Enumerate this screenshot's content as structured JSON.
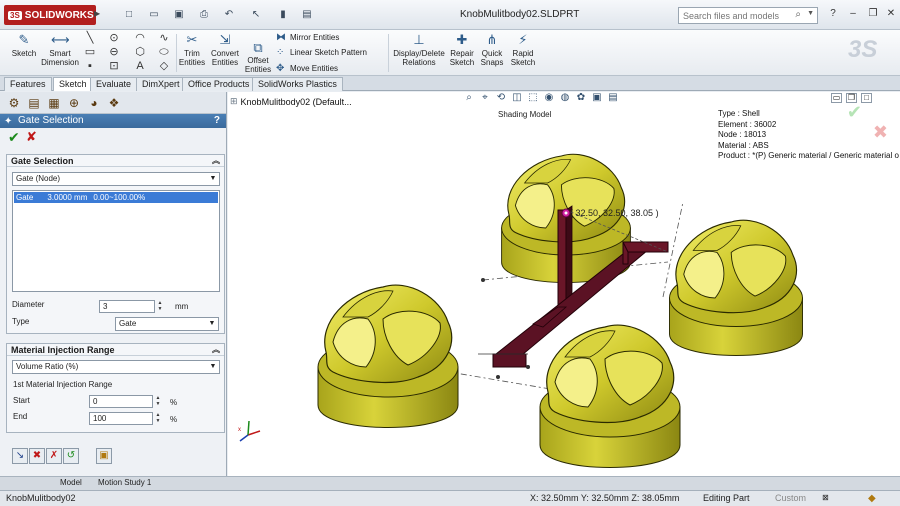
{
  "titlebar": {
    "brand": "SOLIDWORKS",
    "brand_prefix": "3S",
    "document_title": "KnobMulitbody02.SLDPRT",
    "search_placeholder": "Search files and models",
    "help_label": "?"
  },
  "command_manager": {
    "sketch": "Sketch",
    "smart_dimension": [
      "Smart",
      "Dimension"
    ],
    "trim_entities": [
      "Trim",
      "Entities"
    ],
    "convert_entities": [
      "Convert",
      "Entities"
    ],
    "offset_entities": [
      "Offset",
      "Entities"
    ],
    "mirror_entities": "Mirror Entities",
    "linear_sketch_pattern": "Linear Sketch Pattern",
    "move_entities": "Move Entities",
    "display_delete_relations": [
      "Display/Delete",
      "Relations"
    ],
    "repair_sketch": [
      "Repair",
      "Sketch"
    ],
    "quick_snaps": [
      "Quick",
      "Snaps"
    ],
    "rapid_sketch": [
      "Rapid",
      "Sketch"
    ]
  },
  "tabs": [
    "Features",
    "Sketch",
    "Evaluate",
    "DimXpert",
    "Office Products",
    "SolidWorks Plastics"
  ],
  "active_tab": "Sketch",
  "property_manager": {
    "title": "Gate Selection",
    "help": "?",
    "gate_selection": {
      "heading": "Gate Selection",
      "type_value": "Gate (Node)",
      "list_row": {
        "name": "Gate",
        "size": "3.0000 mm",
        "range": "0.00~100.00%"
      },
      "diameter_label": "Diameter",
      "diameter_value": "3",
      "diameter_unit": "mm",
      "type_label": "Type",
      "type_select": "Gate"
    },
    "material_injection": {
      "heading": "Material Injection Range",
      "mode": "Volume Ratio (%)",
      "subheading": "1st Material Injection Range",
      "start_label": "Start",
      "start_value": "0",
      "end_label": "End",
      "end_value": "100",
      "unit": "%"
    }
  },
  "graphics": {
    "tree_root": "KnobMulitbody02  (Default...",
    "shading_label": "Shading Model",
    "info": [
      "Type : Shell",
      "Element : 36002",
      "Node : 18013",
      "Material : ABS",
      "Product :   *(P)  Generic material / Generic material o"
    ],
    "coordinate_callout": "( 32.50, 32.50, 38.05 )"
  },
  "model_tabs": [
    "Model",
    "Motion Study 1"
  ],
  "statusbar": {
    "document": "KnobMulitbody02",
    "coordinates": "X: 32.50mm Y: 32.50mm Z: 38.05mm",
    "mode": "Editing Part",
    "units": "Custom"
  },
  "colors": {
    "knob_yellow": "#c9c52a",
    "runner": "#5a1022",
    "pm_header": "#3a6a9c",
    "selection": "#3b7bd6"
  }
}
